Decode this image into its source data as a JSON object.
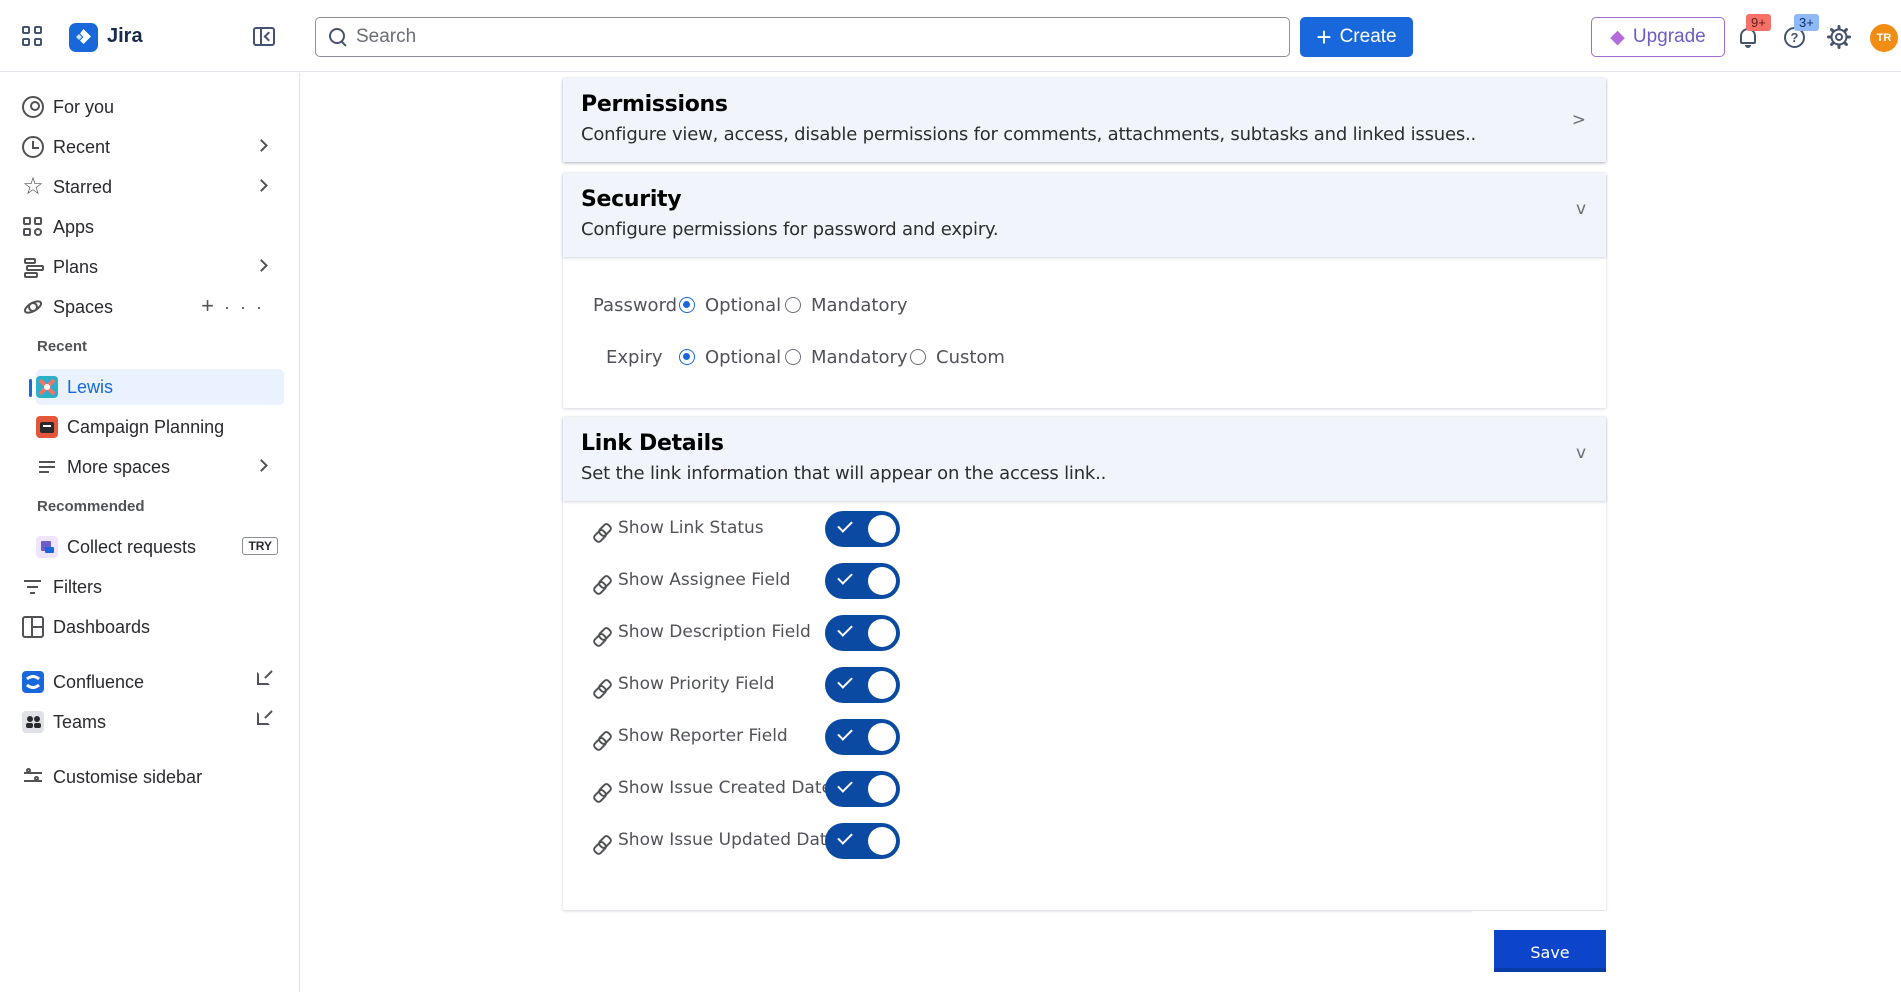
{
  "app": {
    "name": "Jira"
  },
  "header": {
    "search_placeholder": "Search",
    "create_label": "Create",
    "upgrade_label": "Upgrade",
    "notifications_badge": "9+",
    "help_badge": "3+",
    "avatar_initials": "TR"
  },
  "sidebar": {
    "for_you": "For you",
    "recent": "Recent",
    "starred": "Starred",
    "apps": "Apps",
    "plans": "Plans",
    "spaces": "Spaces",
    "recent_heading": "Recent",
    "space_lewis": "Lewis",
    "space_campaign": "Campaign Planning",
    "more_spaces": "More spaces",
    "recommended_heading": "Recommended",
    "collect_requests": "Collect requests",
    "try_badge": "TRY",
    "filters": "Filters",
    "dashboards": "Dashboards",
    "confluence": "Confluence",
    "teams": "Teams",
    "customise": "Customise sidebar"
  },
  "panels": {
    "permissions": {
      "title": "Permissions",
      "description": "Configure view, access, disable permissions for comments, attachments, subtasks and linked issues..",
      "arrow": ">"
    },
    "security": {
      "title": "Security",
      "description": "Configure permissions for password and expiry.",
      "arrow": "v",
      "password_label": "Password",
      "expiry_label": "Expiry",
      "opt_optional": "Optional",
      "opt_mandatory": "Mandatory",
      "opt_custom": "Custom",
      "password_selected": "Optional",
      "expiry_selected": "Optional"
    },
    "link_details": {
      "title": "Link Details",
      "description": "Set the link information that will appear on the access link..",
      "arrow": "v",
      "toggles": [
        {
          "label": "Show Link Status",
          "on": true
        },
        {
          "label": "Show Assignee Field",
          "on": true
        },
        {
          "label": "Show Description Field",
          "on": true
        },
        {
          "label": "Show Priority Field",
          "on": true
        },
        {
          "label": "Show Reporter Field",
          "on": true
        },
        {
          "label": "Show Issue Created Date",
          "on": true
        },
        {
          "label": "Show Issue Updated Date",
          "on": true
        }
      ]
    }
  },
  "actions": {
    "save_label": "Save"
  },
  "colors": {
    "brand": "#1868db",
    "toggle_on": "#0b4aa2",
    "panel_header_bg": "#f1f5fb",
    "save_button": "#0c45c9"
  }
}
